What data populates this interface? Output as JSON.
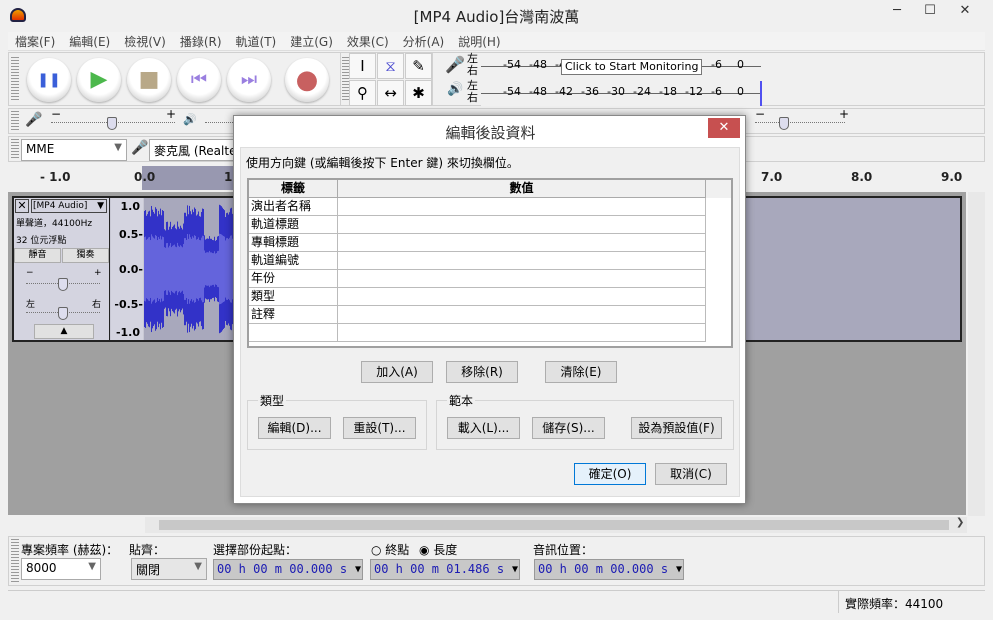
{
  "window": {
    "title": "[MP4 Audio]台灣南波萬",
    "minimize": "─",
    "maximize": "☐",
    "close": "✕"
  },
  "menu": [
    "檔案(F)",
    "編輯(E)",
    "檢視(V)",
    "播錄(R)",
    "軌道(T)",
    "建立(G)",
    "效果(C)",
    "分析(A)",
    "說明(H)"
  ],
  "transport": {
    "pause": "❚❚",
    "play": "▶",
    "stop": "■",
    "skip_start": "⏮",
    "skip_end": "⏭",
    "record": "●",
    "colors": {
      "pause": "#3a5fd9",
      "play": "#4cb84c",
      "stop": "#b8a888",
      "skip": "#9a7fe0",
      "record": "#c86060"
    }
  },
  "tools": {
    "select": "I",
    "envelope": "⧖",
    "draw": "✎",
    "zoom": "⚲",
    "timeshift": "↔",
    "multi": "✱"
  },
  "meters": {
    "left": "左",
    "right": "右",
    "ticks": [
      "-54",
      "-48",
      "-42",
      "-36",
      "-30",
      "-24",
      "-18",
      "-12",
      "-6",
      "0"
    ],
    "tooltip": "Click to Start Monitoring"
  },
  "mixer": {
    "minus": "−",
    "plus": "+"
  },
  "device": {
    "host": "MME",
    "input": "麥克風 (Realte"
  },
  "ruler": [
    "- 1.0",
    "0.0",
    "1",
    "7.0",
    "8.0",
    "9.0"
  ],
  "track": {
    "name": "[MP4 Audio]",
    "info1": "單聲道，44100Hz",
    "info2": "32 位元浮點",
    "mute": "靜音",
    "solo": "獨奏",
    "gain_minus": "−",
    "gain_plus": "+",
    "pan_left": "左",
    "pan_right": "右",
    "collapse": "▲",
    "scale": [
      "1.0",
      "0.5-",
      "0.0-",
      "-0.5-",
      "-1.0"
    ],
    "wave_color": "#3232c8",
    "wave_rms_color": "#6464dc",
    "selection_end_seconds": 1.486
  },
  "dialog": {
    "title": "編輯後設資料",
    "close": "✕",
    "instruction": "使用方向鍵 (或編輯後按下 Enter 鍵) 來切換欄位。",
    "columns": [
      "標籤",
      "數值"
    ],
    "rows": [
      [
        "演出者名稱",
        ""
      ],
      [
        "軌道標題",
        ""
      ],
      [
        "專輯標題",
        ""
      ],
      [
        "軌道編號",
        ""
      ],
      [
        "年份",
        ""
      ],
      [
        "類型",
        ""
      ],
      [
        "註釋",
        ""
      ],
      [
        "",
        ""
      ]
    ],
    "add": "加入(A)",
    "remove": "移除(R)",
    "clear": "清除(E)",
    "genre_group": "類型",
    "edit": "編輯(D)...",
    "reset": "重設(T)...",
    "template_group": "範本",
    "load": "載入(L)...",
    "save": "儲存(S)...",
    "set_default": "設為預設值(F)",
    "ok": "確定(O)",
    "cancel": "取消(C)"
  },
  "selection": {
    "rate_label": "專案頻率 (赫茲)：",
    "rate": "8000",
    "snap_label": "貼齊：",
    "snap": "關閉",
    "start_label": "選擇部份起點：",
    "start": "00 h 00 m 00.000 s",
    "end_radio": "終點",
    "length_radio": "長度",
    "length_selected": true,
    "length": "00 h 00 m 01.486 s",
    "pos_label": "音訊位置：",
    "pos": "00 h 00 m 00.000 s"
  },
  "status": {
    "actual_rate": "實際頻率：44100"
  }
}
